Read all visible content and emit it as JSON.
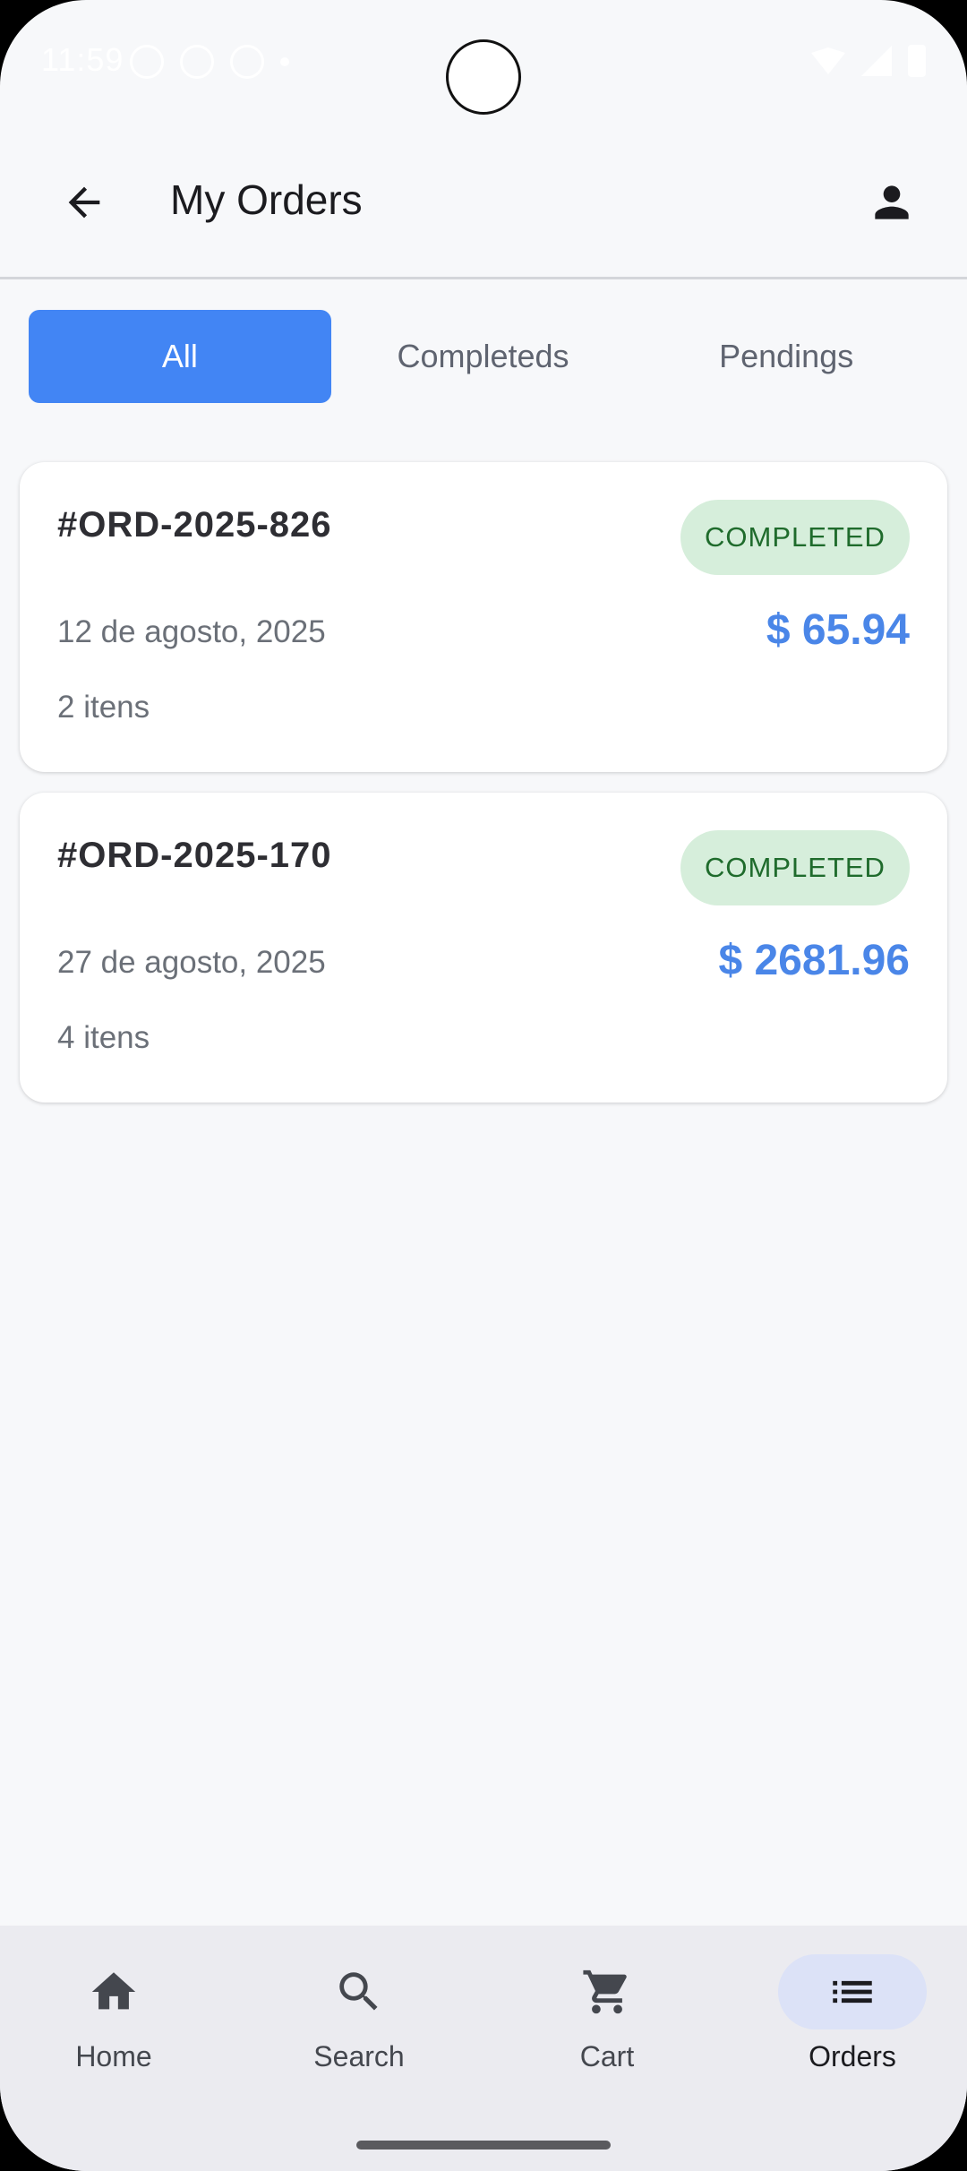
{
  "status_bar": {
    "time": "11:59"
  },
  "app_bar": {
    "title": "My Orders"
  },
  "tabs": [
    {
      "label": "All",
      "active": true
    },
    {
      "label": "Completeds",
      "active": false
    },
    {
      "label": "Pendings",
      "active": false
    }
  ],
  "orders": [
    {
      "id": "#ORD-2025-826",
      "status": "COMPLETED",
      "date": "12 de agosto, 2025",
      "total": "$ 65.94",
      "items": "2 itens"
    },
    {
      "id": "#ORD-2025-170",
      "status": "COMPLETED",
      "date": "27 de agosto, 2025",
      "total": "$ 2681.96",
      "items": "4 itens"
    }
  ],
  "bottom_nav": [
    {
      "label": "Home",
      "icon": "home-icon",
      "active": false
    },
    {
      "label": "Search",
      "icon": "search-icon",
      "active": false
    },
    {
      "label": "Cart",
      "icon": "cart-icon",
      "active": false
    },
    {
      "label": "Orders",
      "icon": "list-icon",
      "active": true
    }
  ],
  "colors": {
    "accent": "#4285f4",
    "price": "#4a86e8",
    "completed_bg": "#d6eedb",
    "completed_text": "#1f6b2c",
    "nav_active_pill": "#dce2f7"
  }
}
